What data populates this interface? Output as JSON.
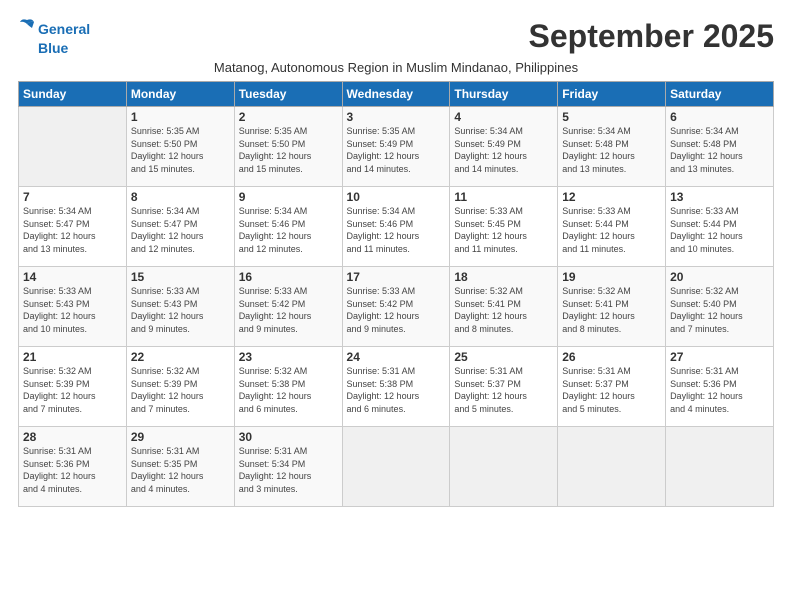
{
  "logo": {
    "line1": "General",
    "line2": "Blue"
  },
  "title": "September 2025",
  "subtitle": "Matanog, Autonomous Region in Muslim Mindanao, Philippines",
  "days_header": [
    "Sunday",
    "Monday",
    "Tuesday",
    "Wednesday",
    "Thursday",
    "Friday",
    "Saturday"
  ],
  "weeks": [
    [
      {
        "num": "",
        "info": ""
      },
      {
        "num": "1",
        "info": "Sunrise: 5:35 AM\nSunset: 5:50 PM\nDaylight: 12 hours\nand 15 minutes."
      },
      {
        "num": "2",
        "info": "Sunrise: 5:35 AM\nSunset: 5:50 PM\nDaylight: 12 hours\nand 15 minutes."
      },
      {
        "num": "3",
        "info": "Sunrise: 5:35 AM\nSunset: 5:49 PM\nDaylight: 12 hours\nand 14 minutes."
      },
      {
        "num": "4",
        "info": "Sunrise: 5:34 AM\nSunset: 5:49 PM\nDaylight: 12 hours\nand 14 minutes."
      },
      {
        "num": "5",
        "info": "Sunrise: 5:34 AM\nSunset: 5:48 PM\nDaylight: 12 hours\nand 13 minutes."
      },
      {
        "num": "6",
        "info": "Sunrise: 5:34 AM\nSunset: 5:48 PM\nDaylight: 12 hours\nand 13 minutes."
      }
    ],
    [
      {
        "num": "7",
        "info": "Sunrise: 5:34 AM\nSunset: 5:47 PM\nDaylight: 12 hours\nand 13 minutes."
      },
      {
        "num": "8",
        "info": "Sunrise: 5:34 AM\nSunset: 5:47 PM\nDaylight: 12 hours\nand 12 minutes."
      },
      {
        "num": "9",
        "info": "Sunrise: 5:34 AM\nSunset: 5:46 PM\nDaylight: 12 hours\nand 12 minutes."
      },
      {
        "num": "10",
        "info": "Sunrise: 5:34 AM\nSunset: 5:46 PM\nDaylight: 12 hours\nand 11 minutes."
      },
      {
        "num": "11",
        "info": "Sunrise: 5:33 AM\nSunset: 5:45 PM\nDaylight: 12 hours\nand 11 minutes."
      },
      {
        "num": "12",
        "info": "Sunrise: 5:33 AM\nSunset: 5:44 PM\nDaylight: 12 hours\nand 11 minutes."
      },
      {
        "num": "13",
        "info": "Sunrise: 5:33 AM\nSunset: 5:44 PM\nDaylight: 12 hours\nand 10 minutes."
      }
    ],
    [
      {
        "num": "14",
        "info": "Sunrise: 5:33 AM\nSunset: 5:43 PM\nDaylight: 12 hours\nand 10 minutes."
      },
      {
        "num": "15",
        "info": "Sunrise: 5:33 AM\nSunset: 5:43 PM\nDaylight: 12 hours\nand 9 minutes."
      },
      {
        "num": "16",
        "info": "Sunrise: 5:33 AM\nSunset: 5:42 PM\nDaylight: 12 hours\nand 9 minutes."
      },
      {
        "num": "17",
        "info": "Sunrise: 5:33 AM\nSunset: 5:42 PM\nDaylight: 12 hours\nand 9 minutes."
      },
      {
        "num": "18",
        "info": "Sunrise: 5:32 AM\nSunset: 5:41 PM\nDaylight: 12 hours\nand 8 minutes."
      },
      {
        "num": "19",
        "info": "Sunrise: 5:32 AM\nSunset: 5:41 PM\nDaylight: 12 hours\nand 8 minutes."
      },
      {
        "num": "20",
        "info": "Sunrise: 5:32 AM\nSunset: 5:40 PM\nDaylight: 12 hours\nand 7 minutes."
      }
    ],
    [
      {
        "num": "21",
        "info": "Sunrise: 5:32 AM\nSunset: 5:39 PM\nDaylight: 12 hours\nand 7 minutes."
      },
      {
        "num": "22",
        "info": "Sunrise: 5:32 AM\nSunset: 5:39 PM\nDaylight: 12 hours\nand 7 minutes."
      },
      {
        "num": "23",
        "info": "Sunrise: 5:32 AM\nSunset: 5:38 PM\nDaylight: 12 hours\nand 6 minutes."
      },
      {
        "num": "24",
        "info": "Sunrise: 5:31 AM\nSunset: 5:38 PM\nDaylight: 12 hours\nand 6 minutes."
      },
      {
        "num": "25",
        "info": "Sunrise: 5:31 AM\nSunset: 5:37 PM\nDaylight: 12 hours\nand 5 minutes."
      },
      {
        "num": "26",
        "info": "Sunrise: 5:31 AM\nSunset: 5:37 PM\nDaylight: 12 hours\nand 5 minutes."
      },
      {
        "num": "27",
        "info": "Sunrise: 5:31 AM\nSunset: 5:36 PM\nDaylight: 12 hours\nand 4 minutes."
      }
    ],
    [
      {
        "num": "28",
        "info": "Sunrise: 5:31 AM\nSunset: 5:36 PM\nDaylight: 12 hours\nand 4 minutes."
      },
      {
        "num": "29",
        "info": "Sunrise: 5:31 AM\nSunset: 5:35 PM\nDaylight: 12 hours\nand 4 minutes."
      },
      {
        "num": "30",
        "info": "Sunrise: 5:31 AM\nSunset: 5:34 PM\nDaylight: 12 hours\nand 3 minutes."
      },
      {
        "num": "",
        "info": ""
      },
      {
        "num": "",
        "info": ""
      },
      {
        "num": "",
        "info": ""
      },
      {
        "num": "",
        "info": ""
      }
    ]
  ]
}
